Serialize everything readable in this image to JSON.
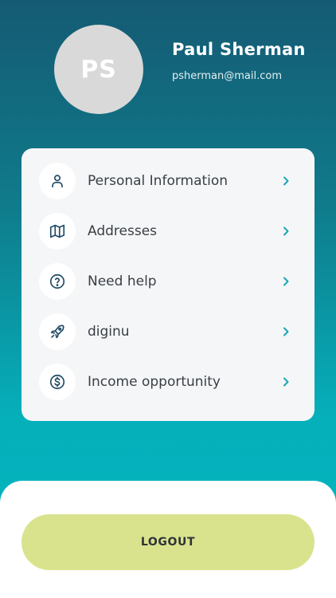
{
  "profile": {
    "initials": "PS",
    "name": "Paul Sherman",
    "email": "psherman@mail.com"
  },
  "menu": {
    "items": [
      {
        "label": "Personal Information",
        "icon": "person-icon"
      },
      {
        "label": "Addresses",
        "icon": "map-icon"
      },
      {
        "label": "Need help",
        "icon": "help-circle-icon"
      },
      {
        "label": "diginu",
        "icon": "rocket-icon"
      },
      {
        "label": "Income opportunity",
        "icon": "dollar-circle-icon"
      }
    ]
  },
  "actions": {
    "logout_label": "LOGOUT"
  },
  "colors": {
    "gradient_top": "#155a73",
    "gradient_bottom": "#03b5bd",
    "icon_color": "#1f4a66",
    "chevron_color": "#1aa6b4",
    "logout_bg": "#d9e38e"
  }
}
